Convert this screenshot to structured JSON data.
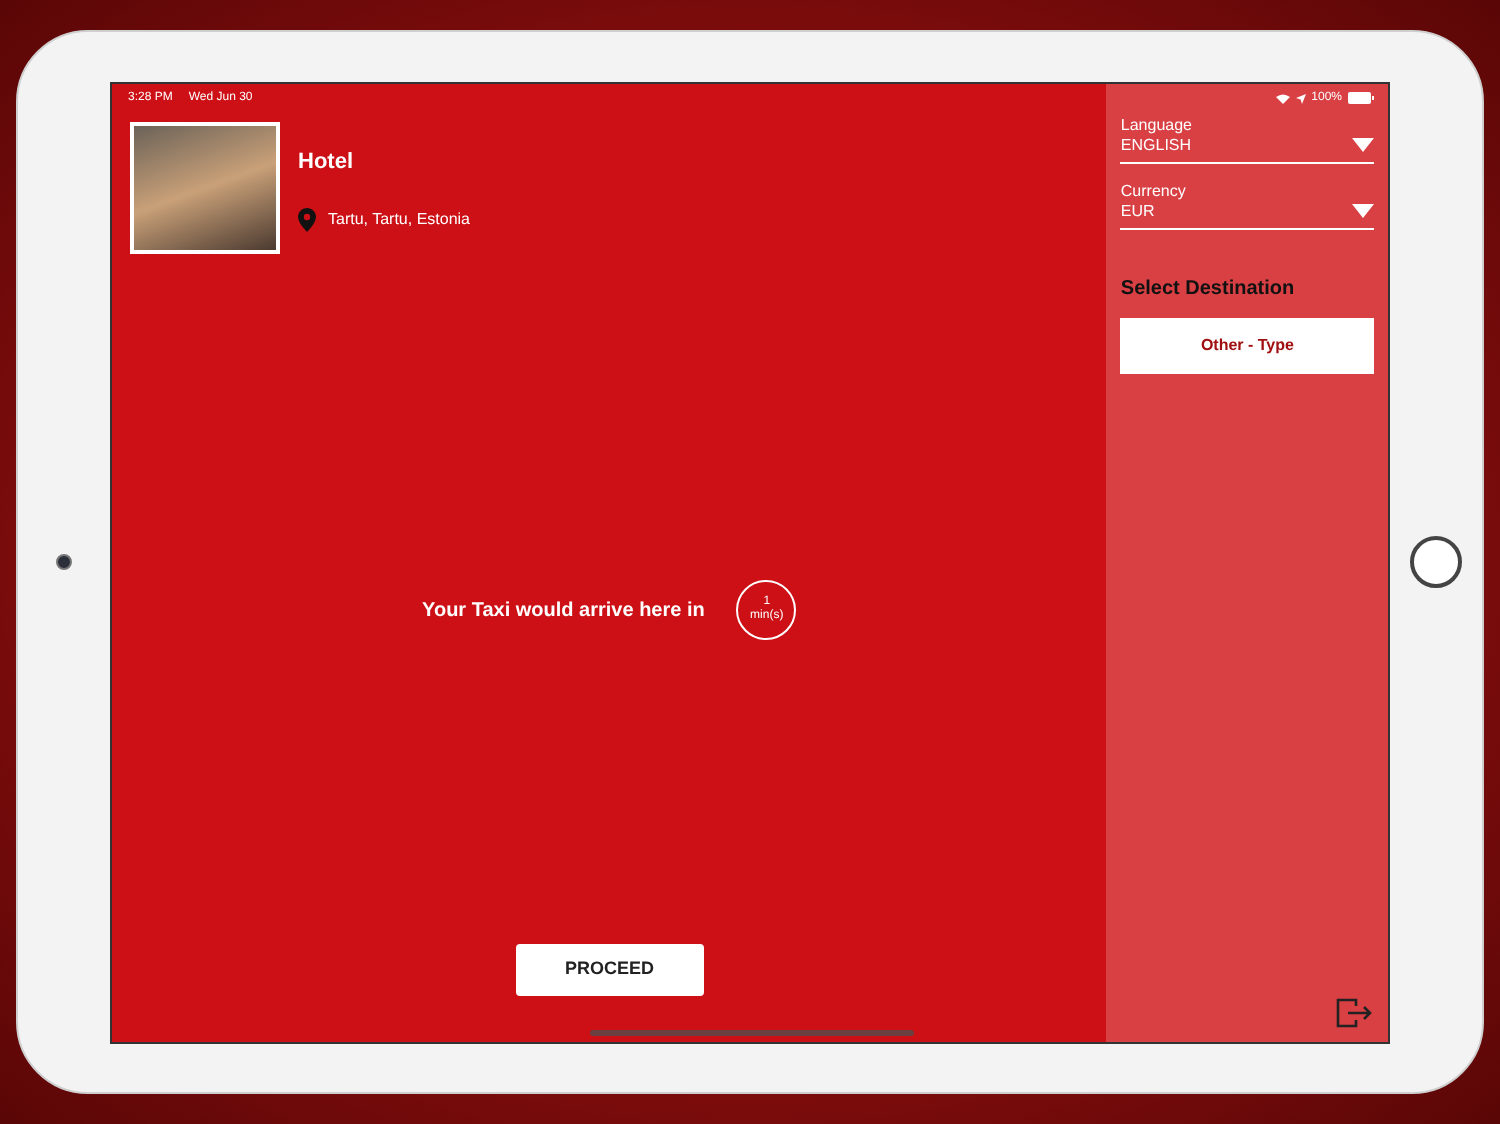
{
  "status_bar": {
    "time": "3:28 PM",
    "date": "Wed Jun 30",
    "battery": "100%"
  },
  "hotel": {
    "name": "Hotel",
    "location": "Tartu, Tartu, Estonia"
  },
  "taxi": {
    "message": "Your Taxi would arrive here in",
    "eta_value": "1",
    "eta_unit": "min(s)"
  },
  "proceed_button": "PROCEED",
  "sidebar": {
    "language": {
      "label": "Language",
      "value": "ENGLISH"
    },
    "currency": {
      "label": "Currency",
      "value": "EUR"
    },
    "destination_title": "Select Destination",
    "destination_button": "Other - Type"
  }
}
